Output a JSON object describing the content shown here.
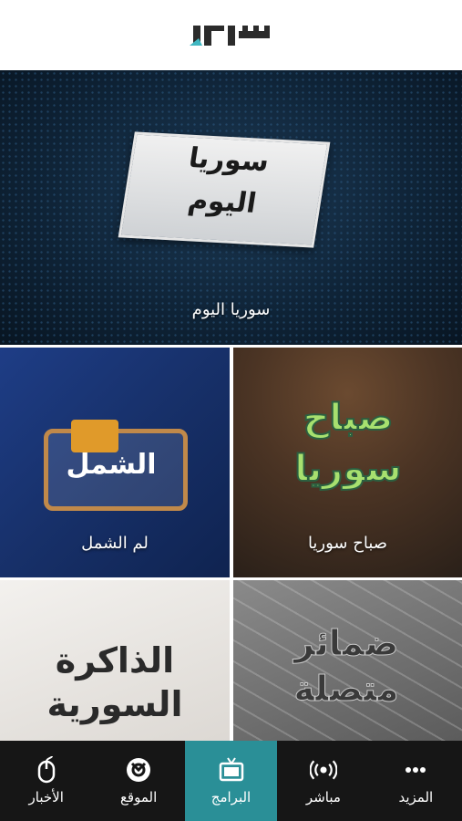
{
  "header": {
    "logo_text": ""
  },
  "tiles": [
    {
      "label": "سوريا اليوم",
      "art_line1": "سوريا",
      "art_line2": "اليوم"
    },
    {
      "label": "لم الشمل",
      "art_text": "الشمل"
    },
    {
      "label": "صباح سوريا",
      "art_line1": "صباح",
      "art_line2": "سوريا"
    },
    {
      "label": "",
      "art_line1": "الذاكرة",
      "art_line2": "السورية"
    },
    {
      "label": "",
      "art_line1": "ضمائر",
      "art_line2": "متصلة"
    }
  ],
  "tabbar": [
    {
      "label": "المزيد",
      "icon": "more-dots-icon"
    },
    {
      "label": "مباشر",
      "icon": "live-broadcast-icon"
    },
    {
      "label": "البرامج",
      "icon": "tv-icon",
      "active": true
    },
    {
      "label": "الموقع",
      "icon": "location-icon"
    },
    {
      "label": "الأخبار",
      "icon": "news-icon"
    }
  ],
  "colors": {
    "active_tab": "#2a8f97",
    "tabbar_bg": "#161616"
  }
}
